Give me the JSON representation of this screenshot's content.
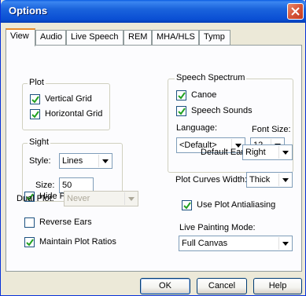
{
  "window": {
    "title": "Options"
  },
  "tabs": [
    {
      "label": "View",
      "active": true
    },
    {
      "label": "Audio",
      "active": false
    },
    {
      "label": "Live Speech",
      "active": false
    },
    {
      "label": "REM",
      "active": false
    },
    {
      "label": "MHA/HLS",
      "active": false
    },
    {
      "label": "Tymp",
      "active": false
    }
  ],
  "plot": {
    "title": "Plot",
    "vertical_grid": {
      "label": "Vertical Grid",
      "checked": true
    },
    "horizontal_grid": {
      "label": "Horizontal Grid",
      "checked": true
    }
  },
  "sight": {
    "title": "Sight",
    "style_label": "Style:",
    "style_value": "Lines",
    "size_label": "Size:",
    "size_value": "50"
  },
  "speech_spectrum": {
    "title": "Speech Spectrum",
    "canoe": {
      "label": "Canoe",
      "checked": true
    },
    "speech_sounds": {
      "label": "Speech Sounds",
      "checked": true
    },
    "language_label": "Language:",
    "language_value": "<Default>",
    "font_size_label": "Font Size:",
    "font_size_value": "12"
  },
  "hide_plots": {
    "label": "Hide Plots During Test",
    "checked": true
  },
  "dual_plot": {
    "label": "Dual Plot:",
    "value": "Never",
    "disabled": true
  },
  "reverse_ears": {
    "label": "Reverse Ears",
    "checked": false
  },
  "maintain_ratios": {
    "label": "Maintain Plot Ratios",
    "checked": true
  },
  "default_ear": {
    "label": "Default Ear:",
    "value": "Right"
  },
  "plot_curves_width": {
    "label": "Plot Curves Width:",
    "value": "Thick"
  },
  "antialiasing": {
    "label": "Use Plot Antialiasing",
    "checked": true
  },
  "live_painting": {
    "label": "Live Painting Mode:",
    "value": "Full Canvas"
  },
  "buttons": {
    "ok": "OK",
    "cancel": "Cancel",
    "help": "Help"
  }
}
